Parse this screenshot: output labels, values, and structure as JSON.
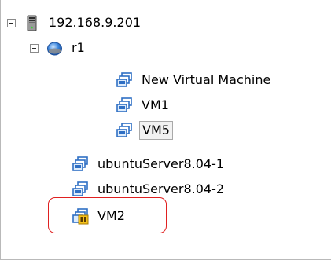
{
  "tree": {
    "host": {
      "label": "192.168.9.201",
      "icon": "server-icon"
    },
    "pool": {
      "label": "r1",
      "icon": "resource-pool-icon"
    },
    "pool_vms": [
      {
        "label": "New Virtual Machine",
        "icon": "vm-icon"
      },
      {
        "label": "VM1",
        "icon": "vm-icon"
      },
      {
        "label": "VM5",
        "icon": "vm-icon",
        "selected": true
      }
    ],
    "host_vms": [
      {
        "label": "ubuntuServer8.04-1",
        "icon": "vm-icon"
      },
      {
        "label": "ubuntuServer8.04-2",
        "icon": "vm-icon"
      },
      {
        "label": "VM2",
        "icon": "vm-suspended-icon"
      }
    ]
  },
  "colors": {
    "highlight_border": "#e02020",
    "selection_bg": "#f2f2f2",
    "vm_blue": "#2f6fc4"
  }
}
